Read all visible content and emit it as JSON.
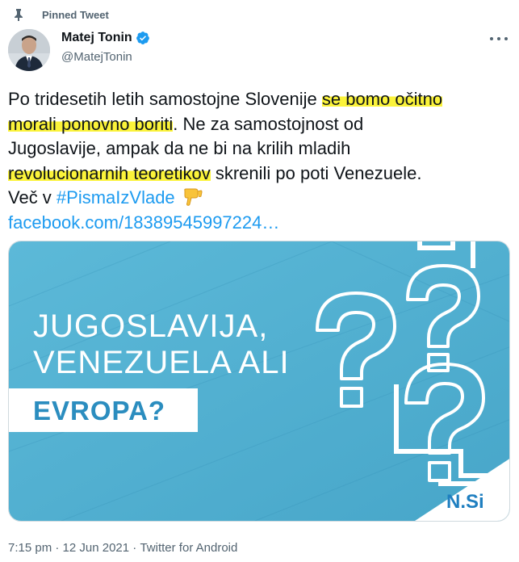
{
  "pinned": {
    "label": "Pinned Tweet"
  },
  "author": {
    "name": "Matej Tonin",
    "handle": "@MatejTonin"
  },
  "tweet": {
    "line1_plain": "Po tridesetih letih samostojne Slovenije ",
    "line1_hl": "se bomo očitno",
    "line2_hl": "morali ponovno boriti",
    "line2_plain": ". Ne za samostojnost od",
    "line3": "Jugoslavije, ampak da ne bi na krilih mladih",
    "line4_hl": "revolucionarnih teoretikov",
    "line4_plain": " skrenili po poti Venezuele.",
    "line5_plain": "Več v ",
    "hashtag": "#PismaIzVlade",
    "link": "facebook.com/18389545997224…"
  },
  "card_image": {
    "line1": "JUGOSLAVIJA,",
    "line2": "VENEZUELA ALI",
    "highlight": "EVROPA?",
    "logo": "N.Si",
    "colors": {
      "bg": "#5bb8d6",
      "box": "#ffffff",
      "box_text": "#2b8dbf",
      "logo": "#1f7fc0"
    }
  },
  "meta": {
    "time": "7:15 pm",
    "sep": " · ",
    "date": "12 Jun 2021",
    "source": "Twitter for Android"
  },
  "colors": {
    "link": "#1d9bf0",
    "highlight": "#fbf33a",
    "muted": "#536471",
    "verified": "#1d9bf0"
  }
}
